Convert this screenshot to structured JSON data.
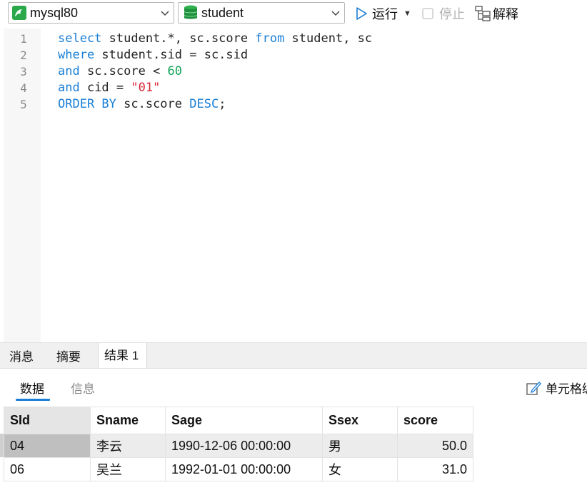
{
  "toolbar": {
    "connection": "mysql80",
    "database": "student",
    "run_label": "运行",
    "stop_label": "停止",
    "explain_label": "解释"
  },
  "editor": {
    "line_numbers": [
      "1",
      "2",
      "3",
      "4",
      "5"
    ],
    "lines": [
      [
        {
          "t": "select",
          "c": "kw"
        },
        {
          "t": " student.*, sc.score ",
          "c": ""
        },
        {
          "t": "from",
          "c": "kw"
        },
        {
          "t": " student, sc",
          "c": ""
        }
      ],
      [
        {
          "t": "where",
          "c": "kw"
        },
        {
          "t": " student.sid = sc.sid",
          "c": ""
        }
      ],
      [
        {
          "t": "and",
          "c": "kw"
        },
        {
          "t": " sc.score < ",
          "c": ""
        },
        {
          "t": "60",
          "c": "num"
        }
      ],
      [
        {
          "t": "and",
          "c": "kw"
        },
        {
          "t": " cid = ",
          "c": ""
        },
        {
          "t": "\"01\"",
          "c": "str"
        }
      ],
      [
        {
          "t": "ORDER BY",
          "c": "kw"
        },
        {
          "t": " sc.score ",
          "c": ""
        },
        {
          "t": "DESC",
          "c": "kw"
        },
        {
          "t": ";",
          "c": ""
        }
      ]
    ]
  },
  "panel": {
    "tabs": [
      "消息",
      "摘要",
      "结果 1"
    ],
    "active_tab": "结果 1",
    "sub_tabs": [
      "数据",
      "信息"
    ],
    "active_sub_tab": "数据",
    "cell_edit_label": "单元格编"
  },
  "results": {
    "columns": [
      "SId",
      "Sname",
      "Sage",
      "Ssex",
      "score"
    ],
    "rows": [
      [
        "04",
        "李云",
        "1990-12-06 00:00:00",
        "男",
        "50.0"
      ],
      [
        "06",
        "吴兰",
        "1992-01-01 00:00:00",
        "女",
        "31.0"
      ]
    ]
  }
}
